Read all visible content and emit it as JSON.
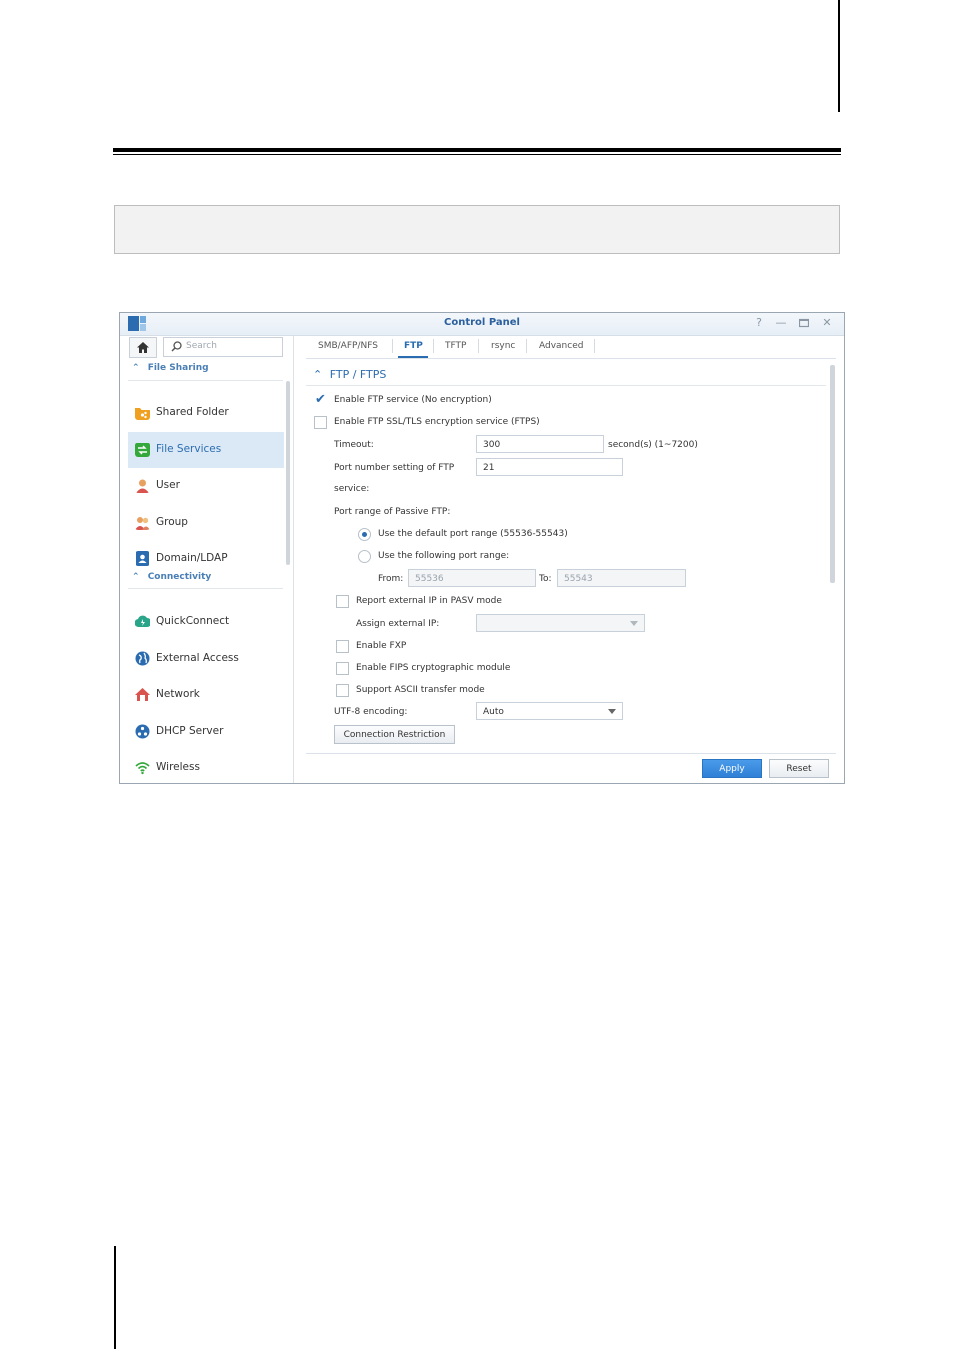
{
  "window": {
    "title": "Control Panel"
  },
  "sidebar": {
    "search_placeholder": "Search",
    "sections": [
      {
        "label": "File Sharing"
      },
      {
        "label": "Connectivity"
      }
    ],
    "items": [
      {
        "label": "Shared Folder",
        "color": "#f0a020"
      },
      {
        "label": "File Services",
        "color": "#35a83c"
      },
      {
        "label": "User",
        "color": "#e8a060"
      },
      {
        "label": "Group",
        "color": "#e07050"
      },
      {
        "label": "Domain/LDAP",
        "color": "#2b6cb0"
      },
      {
        "label": "QuickConnect",
        "color": "#2aa58a"
      },
      {
        "label": "External Access",
        "color": "#2b6cb0"
      },
      {
        "label": "Network",
        "color": "#d9534f"
      },
      {
        "label": "DHCP Server",
        "color": "#2b6cb0"
      },
      {
        "label": "Wireless",
        "color": "#35a83c"
      }
    ]
  },
  "tabs": [
    "SMB/AFP/NFS",
    "FTP",
    "TFTP",
    "rsync",
    "Advanced"
  ],
  "content": {
    "section_title": "FTP / FTPS",
    "enable_ftp": "Enable FTP service (No encryption)",
    "enable_ftps": "Enable FTP SSL/TLS encryption service (FTPS)",
    "timeout_label": "Timeout:",
    "timeout_value": "300",
    "timeout_unit": "second(s) (1~7200)",
    "port_label_1": "Port number setting of FTP",
    "port_label_2": "service:",
    "port_value": "21",
    "passive_label": "Port range of Passive FTP:",
    "radio_default": "Use the default port range (55536-55543)",
    "radio_following": "Use the following port range:",
    "from_label": "From:",
    "from_value": "55536",
    "to_label": "To:",
    "to_value": "55543",
    "report_ip": "Report external IP in PASV mode",
    "assign_ip_label": "Assign external IP:",
    "enable_fxp": "Enable FXP",
    "enable_fips": "Enable FIPS cryptographic module",
    "support_ascii": "Support ASCII transfer mode",
    "utf8_label": "UTF-8 encoding:",
    "utf8_value": "Auto",
    "conn_restriction": "Connection Restriction"
  },
  "footer": {
    "apply": "Apply",
    "reset": "Reset"
  },
  "colors": {
    "accent": "#2b6cb0",
    "selection": "#dbe9f7"
  }
}
